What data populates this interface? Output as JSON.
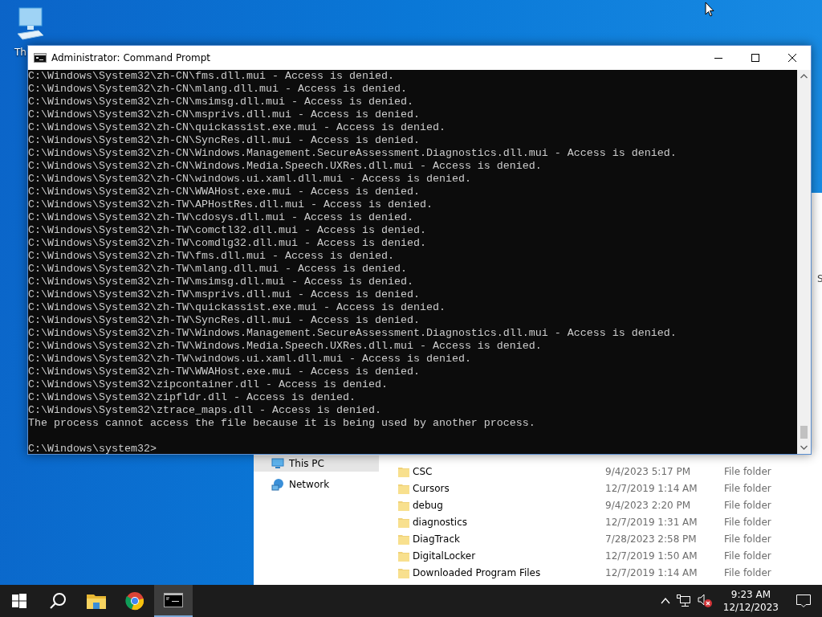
{
  "desktop": {
    "icons": [
      {
        "label": "Th"
      }
    ]
  },
  "explorer": {
    "nav_items": [
      {
        "label": "This PC",
        "selected": true
      },
      {
        "label": "Network",
        "selected": false
      }
    ],
    "edge_text": "S",
    "rows": [
      {
        "name": "CSC",
        "date": "9/4/2023 5:17 PM",
        "type": "File folder"
      },
      {
        "name": "Cursors",
        "date": "12/7/2019 1:14 AM",
        "type": "File folder"
      },
      {
        "name": "debug",
        "date": "9/4/2023 2:20 PM",
        "type": "File folder"
      },
      {
        "name": "diagnostics",
        "date": "12/7/2019 1:31 AM",
        "type": "File folder"
      },
      {
        "name": "DiagTrack",
        "date": "7/28/2023 2:58 PM",
        "type": "File folder"
      },
      {
        "name": "DigitalLocker",
        "date": "12/7/2019 1:50 AM",
        "type": "File folder"
      },
      {
        "name": "Downloaded Program Files",
        "date": "12/7/2019 1:14 AM",
        "type": "File folder"
      }
    ]
  },
  "window": {
    "title": "Administrator: Command Prompt",
    "lines": [
      "C:\\Windows\\System32\\zh-CN\\fms.dll.mui - Access is denied.",
      "C:\\Windows\\System32\\zh-CN\\mlang.dll.mui - Access is denied.",
      "C:\\Windows\\System32\\zh-CN\\msimsg.dll.mui - Access is denied.",
      "C:\\Windows\\System32\\zh-CN\\msprivs.dll.mui - Access is denied.",
      "C:\\Windows\\System32\\zh-CN\\quickassist.exe.mui - Access is denied.",
      "C:\\Windows\\System32\\zh-CN\\SyncRes.dll.mui - Access is denied.",
      "C:\\Windows\\System32\\zh-CN\\Windows.Management.SecureAssessment.Diagnostics.dll.mui - Access is denied.",
      "C:\\Windows\\System32\\zh-CN\\Windows.Media.Speech.UXRes.dll.mui - Access is denied.",
      "C:\\Windows\\System32\\zh-CN\\windows.ui.xaml.dll.mui - Access is denied.",
      "C:\\Windows\\System32\\zh-CN\\WWAHost.exe.mui - Access is denied.",
      "C:\\Windows\\System32\\zh-TW\\APHostRes.dll.mui - Access is denied.",
      "C:\\Windows\\System32\\zh-TW\\cdosys.dll.mui - Access is denied.",
      "C:\\Windows\\System32\\zh-TW\\comctl32.dll.mui - Access is denied.",
      "C:\\Windows\\System32\\zh-TW\\comdlg32.dll.mui - Access is denied.",
      "C:\\Windows\\System32\\zh-TW\\fms.dll.mui - Access is denied.",
      "C:\\Windows\\System32\\zh-TW\\mlang.dll.mui - Access is denied.",
      "C:\\Windows\\System32\\zh-TW\\msimsg.dll.mui - Access is denied.",
      "C:\\Windows\\System32\\zh-TW\\msprivs.dll.mui - Access is denied.",
      "C:\\Windows\\System32\\zh-TW\\quickassist.exe.mui - Access is denied.",
      "C:\\Windows\\System32\\zh-TW\\SyncRes.dll.mui - Access is denied.",
      "C:\\Windows\\System32\\zh-TW\\Windows.Management.SecureAssessment.Diagnostics.dll.mui - Access is denied.",
      "C:\\Windows\\System32\\zh-TW\\Windows.Media.Speech.UXRes.dll.mui - Access is denied.",
      "C:\\Windows\\System32\\zh-TW\\windows.ui.xaml.dll.mui - Access is denied.",
      "C:\\Windows\\System32\\zh-TW\\WWAHost.exe.mui - Access is denied.",
      "C:\\Windows\\System32\\zipcontainer.dll - Access is denied.",
      "C:\\Windows\\System32\\zipfldr.dll - Access is denied.",
      "C:\\Windows\\System32\\ztrace_maps.dll - Access is denied.",
      "The process cannot access the file because it is being used by another process."
    ],
    "prompt": "C:\\Windows\\system32>"
  },
  "taskbar": {
    "apps": [
      {
        "kind": "explorer",
        "selected": false
      },
      {
        "kind": "chrome",
        "selected": false
      },
      {
        "kind": "cmd",
        "selected": true
      }
    ],
    "time": "9:23 AM",
    "date": "12/12/2023"
  }
}
